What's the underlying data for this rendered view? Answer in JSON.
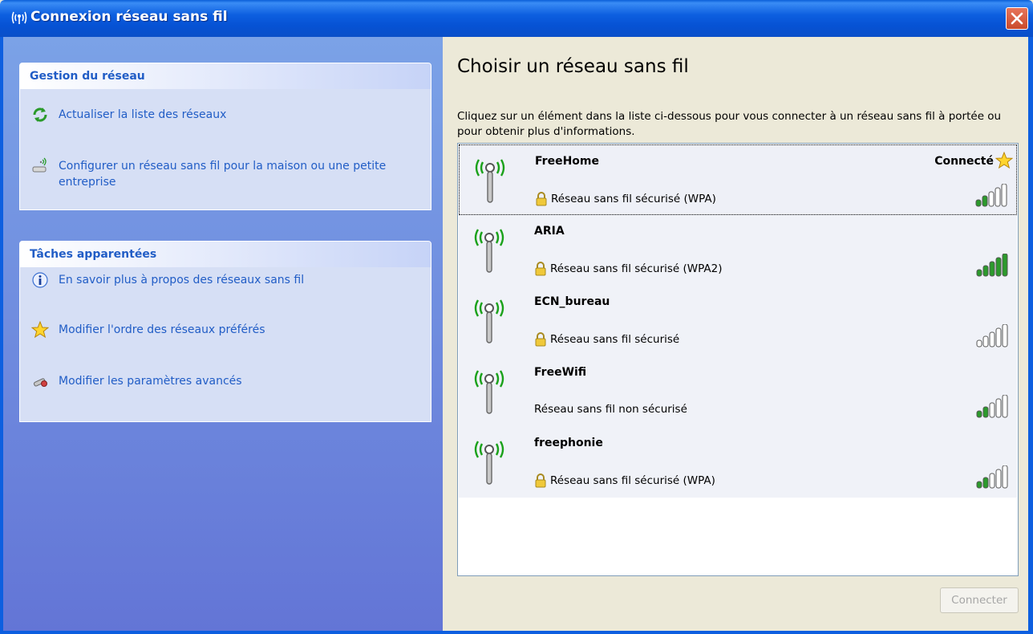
{
  "window": {
    "title": "Connexion réseau sans fil"
  },
  "sidebar": {
    "network_tasks": {
      "header": "Gestion du réseau",
      "items": [
        {
          "label": "Actualiser la liste des réseaux",
          "icon": "refresh-icon"
        },
        {
          "label": "Configurer un réseau sans fil pour la maison ou une petite entreprise",
          "icon": "wireless-setup-icon"
        }
      ]
    },
    "related_tasks": {
      "header": "Tâches apparentées",
      "items": [
        {
          "label": "En savoir plus à propos des réseaux sans fil",
          "icon": "info-icon"
        },
        {
          "label": "Modifier l'ordre des réseaux préférés",
          "icon": "star-icon"
        },
        {
          "label": "Modifier les paramètres avancés",
          "icon": "settings-icon"
        }
      ]
    }
  },
  "main": {
    "heading": "Choisir un réseau sans fil",
    "instructions": "Cliquez sur un élément dans la liste ci-dessous pour vous connecter à un réseau sans fil à portée ou pour obtenir plus d'informations.",
    "networks": [
      {
        "name": "FreeHome",
        "security": "Réseau sans fil sécurisé (WPA)",
        "secured": true,
        "status": "Connecté",
        "signal_bars": 2,
        "selected": true
      },
      {
        "name": "ARIA",
        "security": "Réseau sans fil sécurisé (WPA2)",
        "secured": true,
        "status": "",
        "signal_bars": 5,
        "selected": false
      },
      {
        "name": "ECN_bureau",
        "security": "Réseau sans fil sécurisé",
        "secured": true,
        "status": "",
        "signal_bars": 0,
        "selected": false
      },
      {
        "name": "FreeWifi",
        "security": "Réseau sans fil non sécurisé",
        "secured": false,
        "status": "",
        "signal_bars": 2,
        "selected": false
      },
      {
        "name": "freephonie",
        "security": "Réseau sans fil sécurisé (WPA)",
        "secured": true,
        "status": "",
        "signal_bars": 2,
        "selected": false
      }
    ],
    "connect_label": "Connecter"
  },
  "colors": {
    "titlebar": "#0d5fe0",
    "link": "#215dc6",
    "signal_active": "#2c9a2c",
    "signal_inactive": "#ffffff",
    "antenna_wave": "#1aa11a"
  }
}
